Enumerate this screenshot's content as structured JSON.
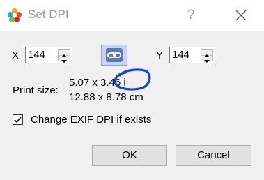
{
  "window": {
    "title": "Set DPI",
    "help_glyph": "?",
    "icon": "app-flower-icon",
    "close_icon": "close-icon"
  },
  "dpi": {
    "x_label": "X",
    "x_value": "144",
    "y_label": "Y",
    "y_value": "144",
    "link_icon": "chain-link-icon"
  },
  "print_size": {
    "label": "Print size:",
    "inches": "5.07 x 3.46 i",
    "centimeters": "12.88 x 8.78 cm"
  },
  "options": {
    "change_exif_label": "Change EXIF DPI if exists",
    "change_exif_checked": true
  },
  "buttons": {
    "ok_label": "OK",
    "cancel_label": "Cancel"
  },
  "colors": {
    "accent": "#5a78b8",
    "annotation": "#1a3fd6"
  }
}
